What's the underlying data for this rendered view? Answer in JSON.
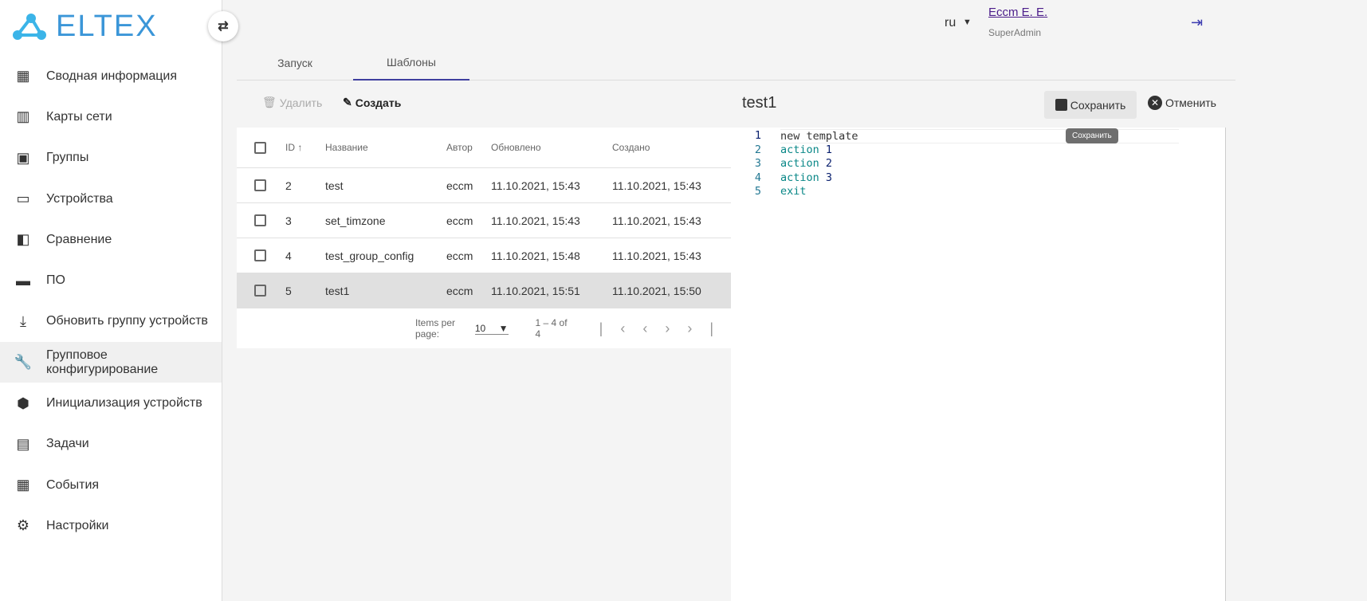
{
  "logo": {
    "text": "ELTEX"
  },
  "sidebar": {
    "items": [
      {
        "label": "Сводная информация",
        "icon": "dashboard-icon"
      },
      {
        "label": "Карты сети",
        "icon": "map-icon"
      },
      {
        "label": "Группы",
        "icon": "photo-library-icon"
      },
      {
        "label": "Устройства",
        "icon": "devices-icon"
      },
      {
        "label": "Сравнение",
        "icon": "compare-icon"
      },
      {
        "label": "ПО",
        "icon": "store-icon"
      },
      {
        "label": "Обновить группу устройств",
        "icon": "download-box-icon"
      },
      {
        "label": "Групповое конфигурирование",
        "icon": "wrench-icon"
      },
      {
        "label": "Инициализация устройств",
        "icon": "auto-badge-icon"
      },
      {
        "label": "Задачи",
        "icon": "clipboard-icon"
      },
      {
        "label": "События",
        "icon": "calendar-icon"
      },
      {
        "label": "Настройки",
        "icon": "gear-icon"
      }
    ]
  },
  "header": {
    "lang": "ru",
    "user": "Eccm E. E.",
    "role": "SuperAdmin"
  },
  "tabs": [
    {
      "label": "Запуск"
    },
    {
      "label": "Шаблоны"
    }
  ],
  "toolbar": {
    "delete": "Удалить",
    "create": "Создать",
    "title": "test1",
    "save": "Сохранить",
    "cancel": "Отменить",
    "tooltip": "Сохранить"
  },
  "table": {
    "headers": {
      "id": "ID",
      "name": "Название",
      "author": "Автор",
      "updated": "Обновлено",
      "created": "Создано"
    },
    "rows": [
      {
        "id": "2",
        "name": "test",
        "author": "eccm",
        "updated": "11.10.2021, 15:43",
        "created": "11.10.2021, 15:43"
      },
      {
        "id": "3",
        "name": "set_timzone",
        "author": "eccm",
        "updated": "11.10.2021, 15:43",
        "created": "11.10.2021, 15:43"
      },
      {
        "id": "4",
        "name": "test_group_config",
        "author": "eccm",
        "updated": "11.10.2021, 15:48",
        "created": "11.10.2021, 15:43"
      },
      {
        "id": "5",
        "name": "test1",
        "author": "eccm",
        "updated": "11.10.2021, 15:51",
        "created": "11.10.2021, 15:50"
      }
    ]
  },
  "pager": {
    "label": "Items per page:",
    "size": "10",
    "range": "1 – 4 of 4"
  },
  "editor": {
    "lines": [
      {
        "n": "1",
        "a": "new template",
        "b": ""
      },
      {
        "n": "2",
        "a": "action",
        "b": "1"
      },
      {
        "n": "3",
        "a": "action",
        "b": "2"
      },
      {
        "n": "4",
        "a": "action",
        "b": "3"
      },
      {
        "n": "5",
        "a": "exit",
        "b": ""
      }
    ]
  }
}
